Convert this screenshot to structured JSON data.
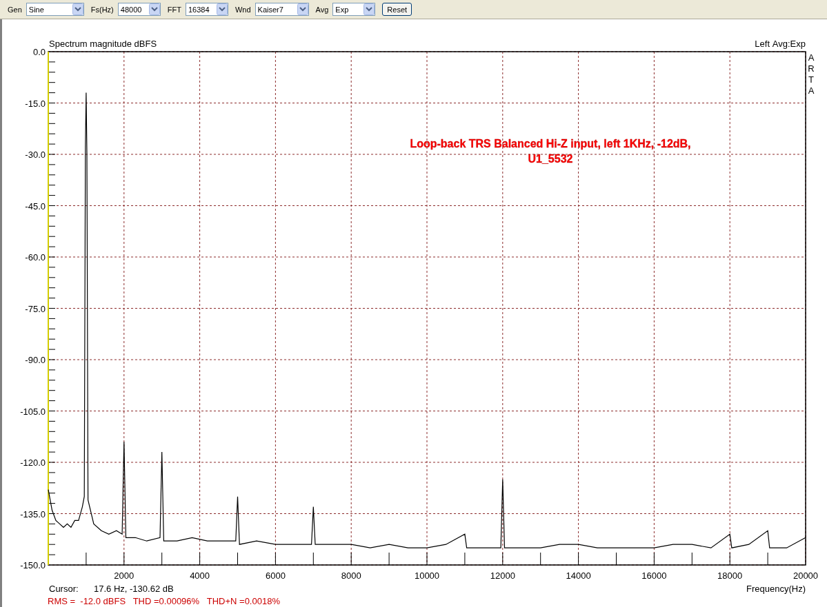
{
  "toolbar": {
    "controls": [
      {
        "label": "Gen",
        "value": "Sine"
      },
      {
        "label": "Fs(Hz)",
        "value": "48000"
      },
      {
        "label": "FFT",
        "value": "16384"
      },
      {
        "label": "Wnd",
        "value": "Kaiser7"
      },
      {
        "label": "Avg",
        "value": "Exp"
      }
    ],
    "button": "Reset"
  },
  "plot": {
    "averaging": "Avg:Exp",
    "brand": "ARTA",
    "cursor_label": "Cursor:",
    "cursor_value": "17.6 Hz, -130.62 dB",
    "measurements": "RMS =  -12.0 dBFS   THD =0.00096%   THD+N =0.0018%",
    "chart_data": {
      "type": "line",
      "grid": true,
      "title": "Spectrum magnitude dBFS",
      "xlabel": "Frequency(Hz)",
      "xlim": [
        0,
        20000
      ],
      "ylim": [
        -150,
        0
      ],
      "xticks": [
        2000,
        4000,
        6000,
        8000,
        10000,
        12000,
        14000,
        16000,
        18000,
        20000
      ],
      "yticks": [
        {
          "value": 0,
          "label": "0.0"
        },
        {
          "value": -15,
          "label": "-15.0"
        },
        {
          "value": -30,
          "label": "-30.0"
        },
        {
          "value": -45,
          "label": "-45.0"
        },
        {
          "value": -60,
          "label": "-60.0"
        },
        {
          "value": -75,
          "label": "-75.0"
        },
        {
          "value": -90,
          "label": "-90.0"
        },
        {
          "value": -105,
          "label": "-105.0"
        },
        {
          "value": -120,
          "label": "-120.0"
        },
        {
          "value": -135,
          "label": "-135.0"
        },
        {
          "value": -150,
          "label": "-150.0"
        }
      ],
      "x": [
        0,
        100,
        200,
        300,
        400,
        500,
        600,
        700,
        800,
        900,
        950,
        980,
        1000,
        1020,
        1050,
        1200,
        1400,
        1600,
        1800,
        1950,
        2000,
        2050,
        2300,
        2600,
        2950,
        3000,
        3050,
        3400,
        3800,
        4200,
        4600,
        4950,
        5000,
        5050,
        5500,
        6000,
        6500,
        6950,
        7000,
        7050,
        7500,
        8000,
        8500,
        9000,
        9500,
        10000,
        10500,
        11000,
        11050,
        11500,
        11950,
        12000,
        12050,
        12500,
        13000,
        13500,
        14000,
        14500,
        15000,
        15500,
        16000,
        16500,
        17000,
        17500,
        18000,
        18050,
        18500,
        19000,
        19050,
        19500,
        20000
      ],
      "series": [
        {
          "name": "Left",
          "color": "#000000",
          "values": [
            -128,
            -134,
            -137,
            -138,
            -139,
            -138,
            -139,
            -137,
            -137,
            -133,
            -130,
            -28,
            -12,
            -30,
            -131,
            -138,
            -140,
            -141,
            -140,
            -141,
            -114,
            -142,
            -142,
            -143,
            -142,
            -117,
            -143,
            -143,
            -142,
            -143,
            -143,
            -143,
            -130,
            -144,
            -143,
            -144,
            -144,
            -144,
            -133,
            -144,
            -144,
            -144,
            -145,
            -144,
            -145,
            -145,
            -144,
            -141,
            -145,
            -145,
            -145,
            -125,
            -145,
            -145,
            -145,
            -144,
            -144,
            -145,
            -145,
            -145,
            -145,
            -144,
            -144,
            -145,
            -141,
            -145,
            -144,
            -140,
            -145,
            -145,
            -142
          ]
        }
      ],
      "annotations": [
        "Loop-back TRS Balanced Hi-Z input, left 1KHz, -12dB,",
        "U1_5532"
      ]
    }
  }
}
